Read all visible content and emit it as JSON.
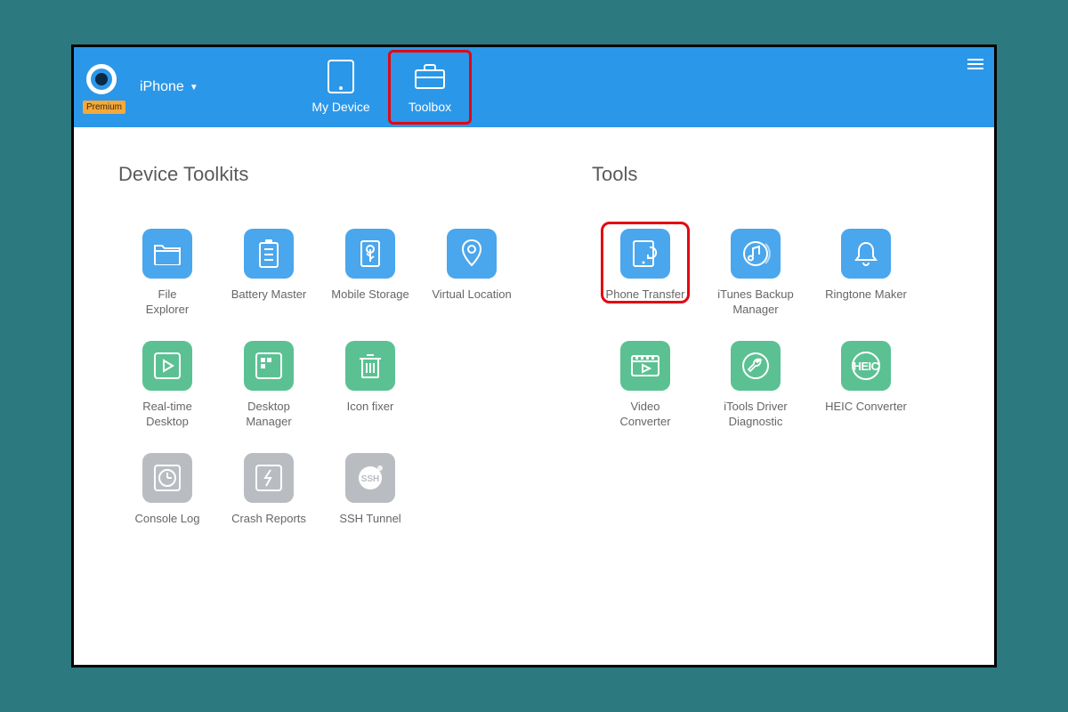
{
  "header": {
    "premium_badge": "Premium",
    "device_name": "iPhone",
    "tabs": [
      {
        "label": "My Device",
        "icon": "tablet-icon",
        "highlighted": false
      },
      {
        "label": "Toolbox",
        "icon": "toolbox-icon",
        "highlighted": true
      }
    ]
  },
  "sections": {
    "device_toolkits": {
      "title": "Device Toolkits",
      "items": [
        {
          "label": "File\nExplorer",
          "icon": "folder-icon",
          "color": "blue"
        },
        {
          "label": "Battery Master",
          "icon": "battery-icon",
          "color": "blue"
        },
        {
          "label": "Mobile Storage",
          "icon": "usb-icon",
          "color": "blue"
        },
        {
          "label": "Virtual Location",
          "icon": "location-icon",
          "color": "blue"
        },
        {
          "label": "Real-time\nDesktop",
          "icon": "play-icon",
          "color": "green"
        },
        {
          "label": "Desktop\nManager",
          "icon": "grid-icon",
          "color": "green"
        },
        {
          "label": "Icon fixer",
          "icon": "trash-icon",
          "color": "green"
        },
        {
          "label": "",
          "icon": "",
          "color": ""
        },
        {
          "label": "Console Log",
          "icon": "clock-icon",
          "color": "gray"
        },
        {
          "label": "Crash Reports",
          "icon": "bolt-icon",
          "color": "gray"
        },
        {
          "label": "SSH Tunnel",
          "icon": "ssh-icon",
          "color": "gray"
        }
      ]
    },
    "tools": {
      "title": "Tools",
      "items": [
        {
          "label": "Phone Transfer",
          "icon": "phone-transfer-icon",
          "color": "blue",
          "highlighted": true
        },
        {
          "label": "iTunes Backup\nManager",
          "icon": "itunes-icon",
          "color": "blue"
        },
        {
          "label": "Ringtone Maker",
          "icon": "bell-icon",
          "color": "blue"
        },
        {
          "label": "Video\nConverter",
          "icon": "video-icon",
          "color": "green"
        },
        {
          "label": "iTools Driver\nDiagnostic",
          "icon": "wrench-icon",
          "color": "green"
        },
        {
          "label": "HEIC Converter",
          "icon": "heic-icon",
          "color": "green",
          "icon_text": "HEIC"
        }
      ]
    }
  }
}
